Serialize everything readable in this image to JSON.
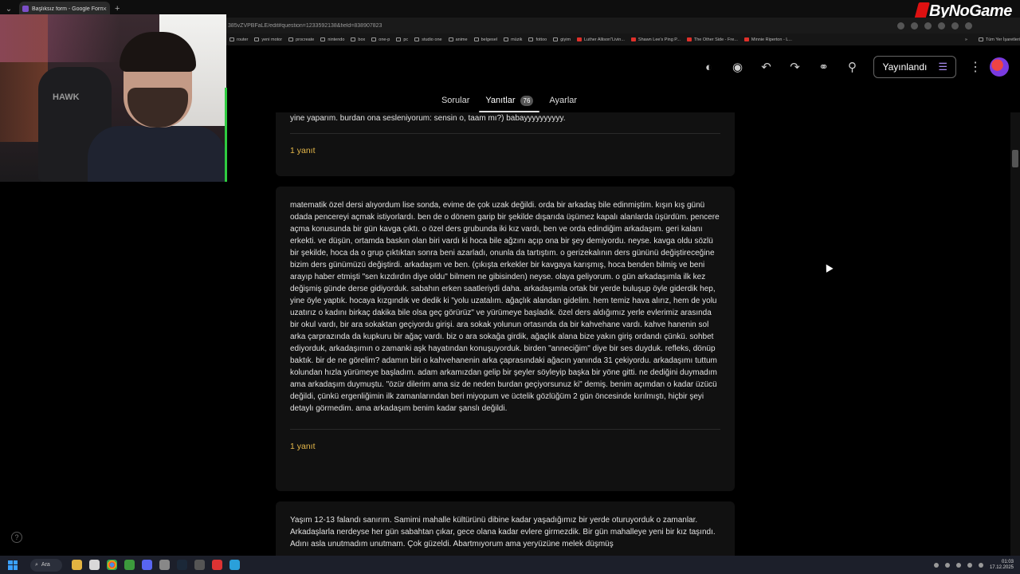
{
  "browser": {
    "tab_title": "Başlıksız form - Google Formlar",
    "tab_close": "×",
    "newtab": "+",
    "url": "385vZVPBFaLE/edit#question=1233592138&field=838907823",
    "bookmarks": [
      {
        "label": "router",
        "kind": "folder"
      },
      {
        "label": "yeni motor",
        "kind": "folder"
      },
      {
        "label": "procreate",
        "kind": "folder"
      },
      {
        "label": "nintendo",
        "kind": "folder"
      },
      {
        "label": "box",
        "kind": "folder"
      },
      {
        "label": "one-p",
        "kind": "folder"
      },
      {
        "label": "pc",
        "kind": "folder"
      },
      {
        "label": "studio one",
        "kind": "folder"
      },
      {
        "label": "anime",
        "kind": "folder"
      },
      {
        "label": "belgesel",
        "kind": "folder"
      },
      {
        "label": "müzik",
        "kind": "folder"
      },
      {
        "label": "fottoo",
        "kind": "folder"
      },
      {
        "label": "giyim",
        "kind": "folder"
      },
      {
        "label": "Luther Allison\"Livin...",
        "kind": "yt"
      },
      {
        "label": "Shawn Lee's Ping P...",
        "kind": "yt"
      },
      {
        "label": "The Other Side - Fre...",
        "kind": "yt"
      },
      {
        "label": "Minnie Riperton - L...",
        "kind": "yt"
      }
    ],
    "bookmarks_more": "»",
    "bookmarks_all": "Tüm Yer İşaretleri"
  },
  "logo": "ByNoGame",
  "forms": {
    "publish_label": "Yayınlandı",
    "tabs": [
      {
        "label": "Sorular",
        "active": false
      },
      {
        "label": "Yanıtlar",
        "active": true,
        "badge": "76"
      },
      {
        "label": "Ayarlar",
        "active": false
      }
    ],
    "tool_icons": [
      "palette-icon",
      "eye-icon",
      "undo-icon",
      "redo-icon",
      "link-icon",
      "add-person-icon",
      "more-vert-icon"
    ]
  },
  "webcam": {
    "chair_logo": "HAWK"
  },
  "responses": [
    {
      "text": "yine yaparım. burdan ona sesleniyorum: sensin o, taam mı?) babayyyyyyyyyy.",
      "reply": "1 yanıt"
    },
    {
      "text": "matematik özel dersi alıyordum lise sonda, evime de çok uzak değildi. orda bir arkadaş bile edinmiştim. kışın kış günü odada pencereyi açmak istiyorlardı. ben de o dönem garip bir şekilde dışarıda üşümez kapalı alanlarda üşürdüm. pencere açma konusunda bir gün kavga çıktı. o özel ders grubunda iki kız vardı, ben ve orda edindiğim arkadaşım. geri kalanı erkekti. ve düşün, ortamda baskın olan biri vardı ki hoca bile ağzını açıp ona bir şey demiyordu. neyse. kavga oldu sözlü bir şekilde, hoca da o grup çıktıktan sonra beni azarladı, onunla da tartıştım. o gerizekalının ders gününü değiştireceğine bizim ders günümüzü değiştirdi. arkadaşım ve ben. (çıkışta erkekler bir kavgaya karışmış, hoca benden bilmiş ve beni arayıp haber etmişti \"sen kızdırdın diye oldu\" bilmem ne gibisinden) neyse. olaya geliyorum. o gün arkadaşımla ilk kez değişmiş günde derse gidiyorduk. sabahın erken saatleriydi daha. arkadaşımla ortak bir yerde buluşup öyle giderdik hep, yine öyle yaptık. hocaya kızgındık ve dedik ki \"yolu uzatalım. ağaçlık alandan gidelim. hem temiz hava alırız, hem de yolu uzatırız o kadını birkaç dakika bile olsa geç görürüz\" ve yürümeye başladık. özel ders aldığımız yerle evlerimiz arasında bir okul vardı, bir ara sokaktan geçiyordu girişi. ara sokak yolunun ortasında da bir kahvehane vardı. kahve hanenin sol arka çarprazında da kupkuru bir ağaç vardı. biz o ara sokağa girdik, ağaçlık alana bize yakın giriş ordandı çünkü. sohbet ediyorduk, arkadaşımın o zamanki aşk hayatından konuşuyorduk. birden \"anneciğim\" diye bir ses duyduk. refleks, dönüp baktık. bir de ne görelim? adamın biri o kahvehanenin arka çaprasındaki ağacın yanında 31 çekiyordu. arkadaşımı tuttum kolundan hızla yürümeye başladım. adam arkamızdan gelip bir şeyler söyleyip başka bir yöne gitti. ne dediğini duymadım ama arkadaşım duymuştu. \"özür dilerim ama siz de neden burdan geçiyorsunuz ki\" demiş. benim açımdan o kadar üzücü değildi, çünkü ergenliğimin ilk zamanlarından beri miyopum ve üctelik gözlüğüm 2 gün öncesinde kırılmıştı, hiçbir şeyi detaylı görmedim. ama arkadaşım benim kadar şanslı değildi.",
      "reply": "1 yanıt"
    },
    {
      "text": "Yaşım 12-13 falandı sanırım. Samimi mahalle kültürünü dibine kadar yaşadığımız bir yerde oturuyorduk o zamanlar. Arkadaşlarla nerdeyse her gün sabahtan çıkar, gece olana kadar evlere girmezdik. Bir gün mahalleye yeni bir kız taşındı. Adını asla unutmadım unutmam. Çok güzeldi. Abartmıyorum ama yeryüzüne melek düşmüş",
      "reply": ""
    }
  ],
  "taskbar": {
    "search_label": "Ara",
    "time": "01:03",
    "date": "17.12.2025"
  },
  "help_label": "?"
}
